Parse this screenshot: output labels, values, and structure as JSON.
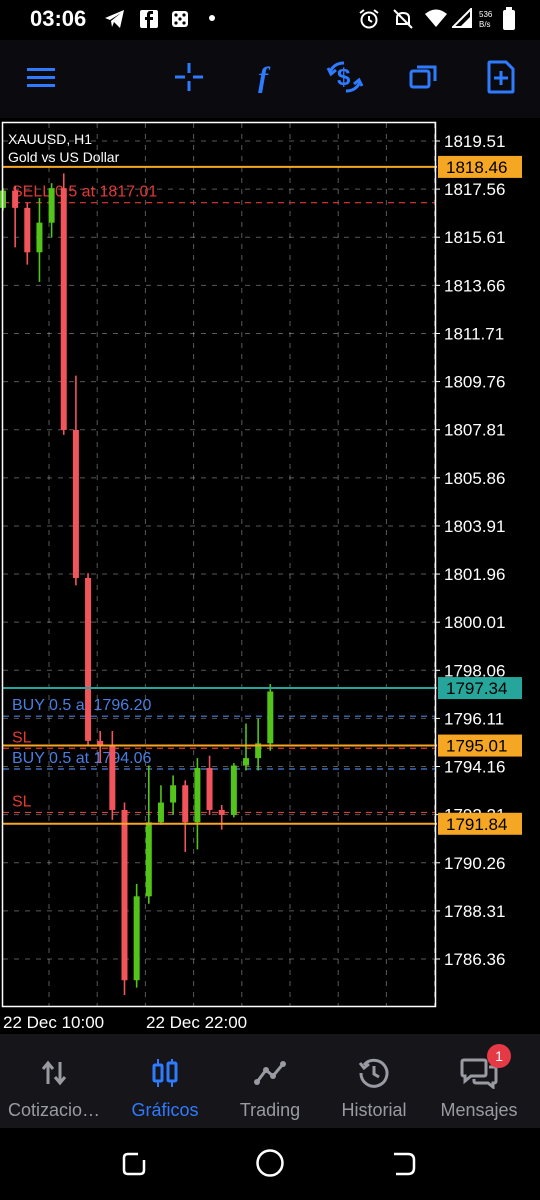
{
  "status_bar": {
    "time": "03:06",
    "net_speed": "536\nB/s"
  },
  "toolbar": {
    "icons": [
      "menu-icon",
      "crosshair-icon",
      "function-icon",
      "trade-icon",
      "windows-icon",
      "new-order-icon"
    ]
  },
  "chart": {
    "symbol_line": "XAUUSD, H1",
    "description": "Gold vs US Dollar",
    "x_ticks": [
      "22 Dec 10:00",
      "22 Dec 22:00"
    ]
  },
  "chart_data": {
    "type": "candlestick",
    "symbol": "XAUUSD",
    "timeframe": "H1",
    "y_ticks": [
      1819.51,
      1817.56,
      1815.61,
      1813.66,
      1811.71,
      1809.76,
      1807.81,
      1805.86,
      1803.91,
      1801.96,
      1800.01,
      1798.06,
      1796.11,
      1794.16,
      1792.21,
      1790.26,
      1788.31,
      1786.36
    ],
    "ylim": [
      1784.5,
      1820.5
    ],
    "price_labels": [
      {
        "value": "1818.46",
        "color": "#f5a623",
        "text_color": "#000000"
      },
      {
        "value": "1797.34",
        "color": "#26a69a",
        "text_color": "#000000"
      },
      {
        "value": "1795.01",
        "color": "#f5a623",
        "text_color": "#000000"
      },
      {
        "value": "1791.84",
        "color": "#f5a623",
        "text_color": "#000000"
      }
    ],
    "order_lines": [
      {
        "label": "SELL 0.5 at 1817.01",
        "price": 1817.01,
        "color": "#e53935"
      },
      {
        "label": "BUY 0.5 at 1796.20",
        "price": 1796.2,
        "color": "#4a7fe0"
      },
      {
        "label": "BUY 0.5 at 1794.06",
        "price": 1794.06,
        "color": "#4a7fe0"
      },
      {
        "label": "SL",
        "price": 1794.9,
        "color": "#e53935"
      },
      {
        "label": "SL",
        "price": 1792.3,
        "color": "#e53935"
      }
    ],
    "candles": [
      {
        "o": 1816.8,
        "h": 1817.6,
        "l": 1816.7,
        "c": 1817.5
      },
      {
        "o": 1817.5,
        "h": 1817.7,
        "l": 1815.2,
        "c": 1816.8
      },
      {
        "o": 1816.8,
        "h": 1817.0,
        "l": 1814.5,
        "c": 1815.0
      },
      {
        "o": 1815.0,
        "h": 1817.2,
        "l": 1813.8,
        "c": 1816.2
      },
      {
        "o": 1816.2,
        "h": 1817.8,
        "l": 1815.6,
        "c": 1817.6
      },
      {
        "o": 1817.6,
        "h": 1818.2,
        "l": 1807.6,
        "c": 1807.8
      },
      {
        "o": 1807.8,
        "h": 1810.0,
        "l": 1801.5,
        "c": 1801.8
      },
      {
        "o": 1801.8,
        "h": 1802.0,
        "l": 1795.0,
        "c": 1795.2
      },
      {
        "o": 1795.2,
        "h": 1795.6,
        "l": 1794.3,
        "c": 1795.0
      },
      {
        "o": 1795.0,
        "h": 1795.6,
        "l": 1792.0,
        "c": 1792.4
      },
      {
        "o": 1792.4,
        "h": 1792.7,
        "l": 1784.9,
        "c": 1785.5
      },
      {
        "o": 1785.5,
        "h": 1789.4,
        "l": 1785.2,
        "c": 1788.9
      },
      {
        "o": 1788.9,
        "h": 1794.2,
        "l": 1788.6,
        "c": 1791.9
      },
      {
        "o": 1791.9,
        "h": 1793.4,
        "l": 1791.8,
        "c": 1792.7
      },
      {
        "o": 1792.7,
        "h": 1793.8,
        "l": 1792.2,
        "c": 1793.4
      },
      {
        "o": 1793.4,
        "h": 1793.6,
        "l": 1790.7,
        "c": 1791.9
      },
      {
        "o": 1791.9,
        "h": 1794.5,
        "l": 1790.8,
        "c": 1794.1
      },
      {
        "o": 1794.1,
        "h": 1794.6,
        "l": 1792.2,
        "c": 1792.4
      },
      {
        "o": 1792.4,
        "h": 1792.6,
        "l": 1791.6,
        "c": 1792.2
      },
      {
        "o": 1792.2,
        "h": 1794.3,
        "l": 1792.1,
        "c": 1794.2
      },
      {
        "o": 1794.2,
        "h": 1795.9,
        "l": 1794.0,
        "c": 1794.5
      },
      {
        "o": 1794.5,
        "h": 1796.1,
        "l": 1794.0,
        "c": 1795.1
      },
      {
        "o": 1795.1,
        "h": 1797.5,
        "l": 1794.8,
        "c": 1797.2
      }
    ]
  },
  "bottom_nav": {
    "items": [
      {
        "label": "Cotizacio…",
        "icon": "sort-arrows-icon"
      },
      {
        "label": "Gráficos",
        "icon": "candles-icon"
      },
      {
        "label": "Trading",
        "icon": "trend-icon"
      },
      {
        "label": "Historial",
        "icon": "history-icon"
      },
      {
        "label": "Mensajes",
        "icon": "messages-icon"
      }
    ],
    "badge": "1"
  }
}
